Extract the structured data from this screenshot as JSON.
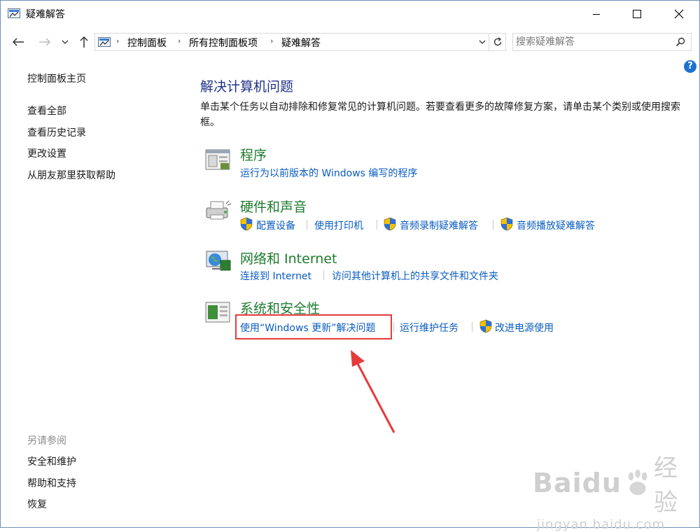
{
  "window": {
    "title": "疑难解答",
    "minimize_label": "最小化",
    "maximize_label": "最大化",
    "close_label": "关闭"
  },
  "nav": {
    "breadcrumbs": [
      "控制面板",
      "所有控制面板项",
      "疑难解答"
    ],
    "search_placeholder": "搜索疑难解答",
    "help_label": "?"
  },
  "sidebar": {
    "home": "控制面板主页",
    "items": [
      "查看全部",
      "查看历史记录",
      "更改设置",
      "从朋友那里获取帮助"
    ],
    "see_also_header": "另请参阅",
    "see_also": [
      "安全和维护",
      "帮助和支持",
      "恢复"
    ]
  },
  "main": {
    "title": "解决计算机问题",
    "description": "单击某个任务以自动排除和修复常见的计算机问题。若要查看更多的故障修复方案，请单击某个类别或使用搜索框。",
    "categories": [
      {
        "title": "程序",
        "icon": "programs-icon",
        "links": [
          "运行为以前版本的 Windows 编写的程序"
        ]
      },
      {
        "title": "硬件和声音",
        "icon": "hardware-sound-icon",
        "links": [
          "配置设备",
          "使用打印机",
          "音频录制疑难解答",
          "音频播放疑难解答"
        ]
      },
      {
        "title": "网络和 Internet",
        "icon": "network-icon",
        "links": [
          "连接到 Internet",
          "访问其他计算机上的共享文件和文件夹"
        ]
      },
      {
        "title": "系统和安全性",
        "icon": "system-security-icon",
        "links": [
          "使用“Windows 更新”解决问题",
          "运行维护任务",
          "改进电源使用"
        ]
      }
    ]
  },
  "watermark": {
    "brand": "Baidu",
    "brand_cn": "经验",
    "url": "jingyan.baidu.com"
  },
  "colors": {
    "category_title": "#1e7b2e",
    "link": "#0a5cc0",
    "heading": "#1e3287",
    "highlight_box": "#e53b3b"
  }
}
